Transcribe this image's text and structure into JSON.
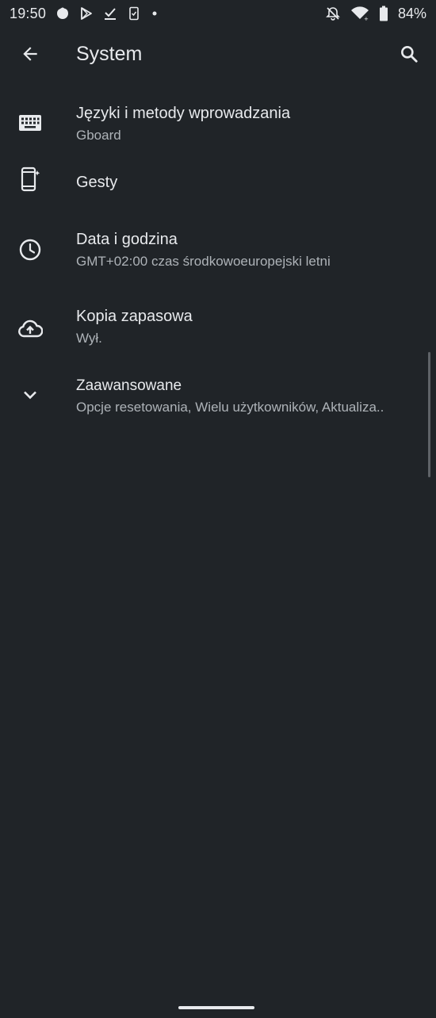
{
  "status_bar": {
    "time": "19:50",
    "battery_percent": "84%",
    "battery_level": 0.84,
    "left_icons": [
      "notification-blob-icon",
      "play-store-icon",
      "download-done-icon",
      "phone-check-icon",
      "dot-icon"
    ],
    "right_icons": [
      "bell-off-icon",
      "wifi-icon",
      "battery-icon"
    ]
  },
  "app_bar": {
    "title": "System",
    "back_icon": "arrow-back-icon",
    "search_icon": "search-icon"
  },
  "items": [
    {
      "icon": "keyboard-icon",
      "title": "Języki i metody wprowadzania",
      "summary": "Gboard"
    },
    {
      "icon": "gestures-phone-icon",
      "title": "Gesty",
      "summary": ""
    },
    {
      "icon": "clock-icon",
      "title": "Data i godzina",
      "summary": "GMT+02:00 czas środkowoeuropejski letni"
    },
    {
      "icon": "cloud-upload-icon",
      "title": "Kopia zapasowa",
      "summary": "Wył."
    },
    {
      "icon": "chevron-down-icon",
      "title": "Zaawansowane",
      "summary": "Opcje resetowania, Wielu użytkowników, Aktualiza.."
    }
  ],
  "colors": {
    "background": "#202428",
    "text_primary": "#e8eaed",
    "text_secondary": "#aeb3b8",
    "scrollbar": "#5f6368"
  }
}
